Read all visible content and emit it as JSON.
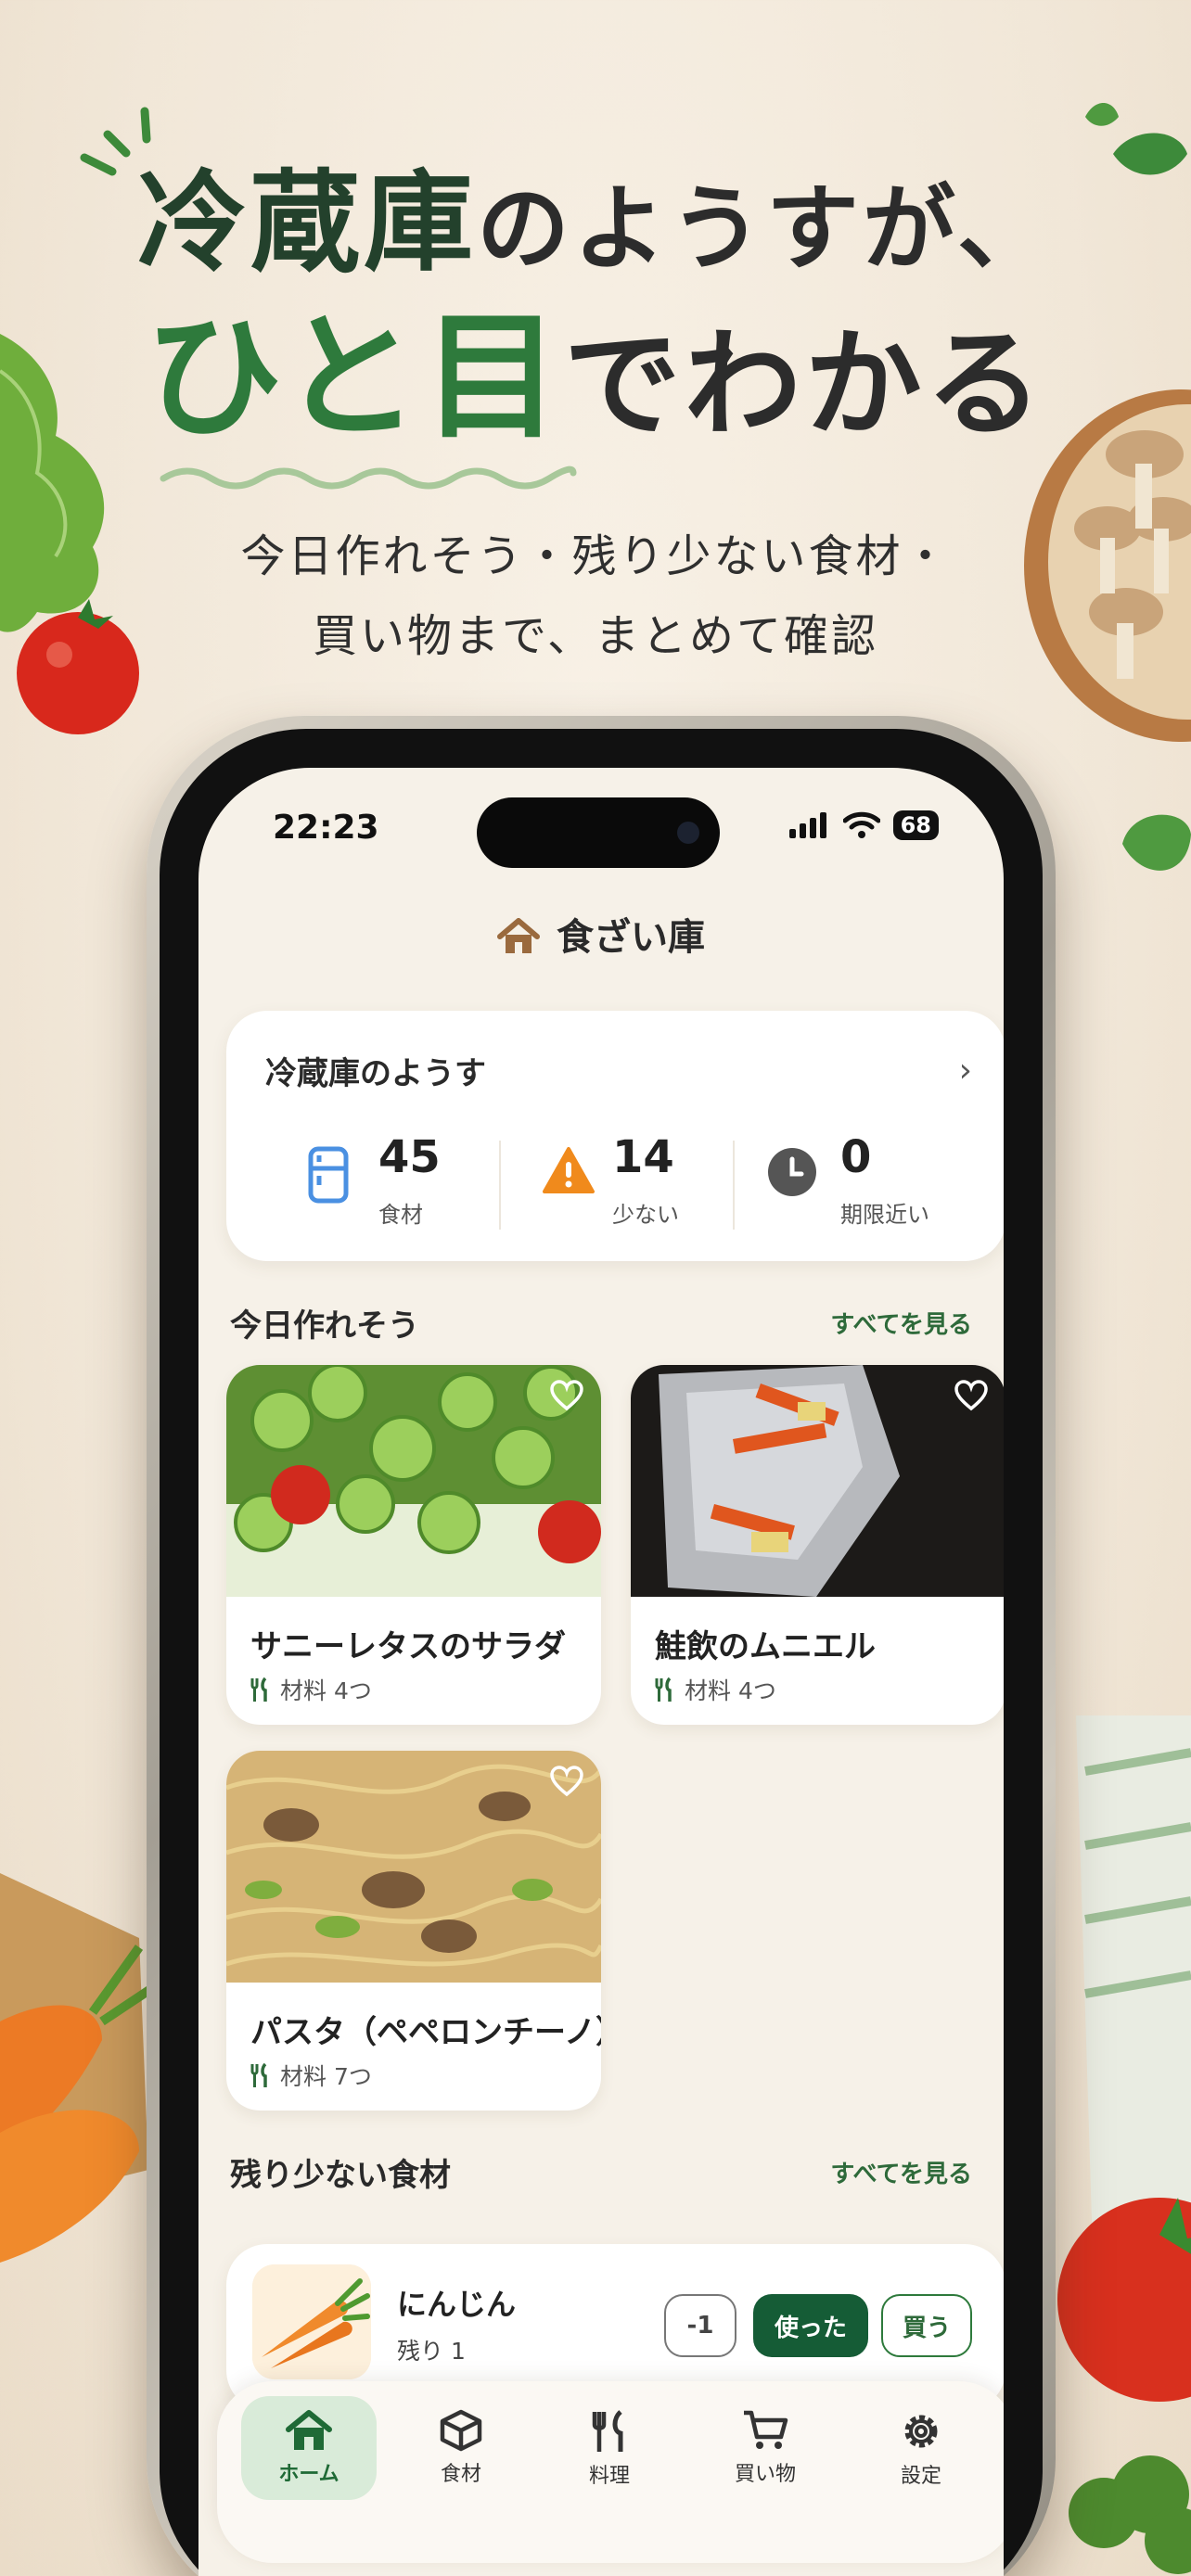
{
  "promo": {
    "headline_a": "冷蔵庫",
    "headline_b": "のようすが、",
    "headline_c": "ひと目",
    "headline_d": "でわかる",
    "subline_1": "今日作れそう・残り少ない食材・",
    "subline_2": "買い物まで、まとめて確認"
  },
  "status_bar": {
    "time": "22:23",
    "battery": "68"
  },
  "app": {
    "title": "食ざい庫"
  },
  "fridge": {
    "title": "冷蔵庫のようす",
    "stats": [
      {
        "value": "45",
        "label": "食材",
        "icon": "fridge-icon",
        "color": "#4a90e2"
      },
      {
        "value": "14",
        "label": "少ない",
        "icon": "warning-icon",
        "color": "#f08a1c"
      },
      {
        "value": "0",
        "label": "期限近い",
        "icon": "clock-icon",
        "color": "#555555"
      }
    ]
  },
  "today": {
    "title": "今日作れそう",
    "see_all": "すべてを見る",
    "recipes": [
      {
        "name": "サニーレタスのサラダ",
        "meta": "材料 4つ"
      },
      {
        "name": "鮭飲のムニエル",
        "meta": "材料 4つ"
      },
      {
        "name": "パスタ（ペペロンチーノ）",
        "meta": "材料 7つ"
      }
    ]
  },
  "low_stock": {
    "title": "残り少ない食材",
    "see_all": "すべてを見る",
    "items": [
      {
        "name": "にんじん",
        "remaining": "残り 1",
        "btn_minus": "-1",
        "btn_used": "使った",
        "btn_buy": "買う"
      }
    ]
  },
  "tabbar": {
    "tabs": [
      {
        "label": "ホーム",
        "icon": "home-icon",
        "active": true
      },
      {
        "label": "食材",
        "icon": "box-icon"
      },
      {
        "label": "料理",
        "icon": "utensils-icon"
      },
      {
        "label": "買い物",
        "icon": "cart-icon"
      },
      {
        "label": "設定",
        "icon": "gear-icon"
      }
    ]
  },
  "colors": {
    "accent_green": "#155c36",
    "background": "#f6f1e8"
  }
}
